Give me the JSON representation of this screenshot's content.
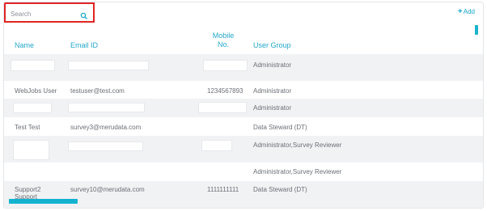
{
  "search": {
    "placeholder": "Search"
  },
  "toolbar": {
    "add_label": "Add"
  },
  "table": {
    "headers": {
      "name": "Name",
      "email": "Email ID",
      "mobile_line1": "Mobile",
      "mobile_line2": "No.",
      "group": "User Group"
    },
    "rows": [
      {
        "name": "",
        "email": "",
        "mobile": "",
        "group": "Administrator"
      },
      {
        "name": "WebJobs User",
        "email": "testuser@test.com",
        "mobile": "1234567893",
        "group": "Administrator"
      },
      {
        "name": "",
        "email": "",
        "mobile": "",
        "group": "Administrator"
      },
      {
        "name": "Test Test",
        "email": "survey3@merudata.com",
        "mobile": "",
        "group": "Data Steward (DT)"
      },
      {
        "name": "",
        "email": "",
        "mobile": "",
        "group": "Administrator,Survey Reviewer"
      },
      {
        "name": "",
        "email": "",
        "mobile": "",
        "group": "Administrator,Survey Reviewer"
      },
      {
        "name": "Support2",
        "name_line2": "Support",
        "email": "survey10@merudata.com",
        "mobile": "1111111111",
        "group": "Data Steward (DT)"
      }
    ]
  },
  "colors": {
    "accent": "#1aa6c8",
    "highlight": "#e02424"
  }
}
